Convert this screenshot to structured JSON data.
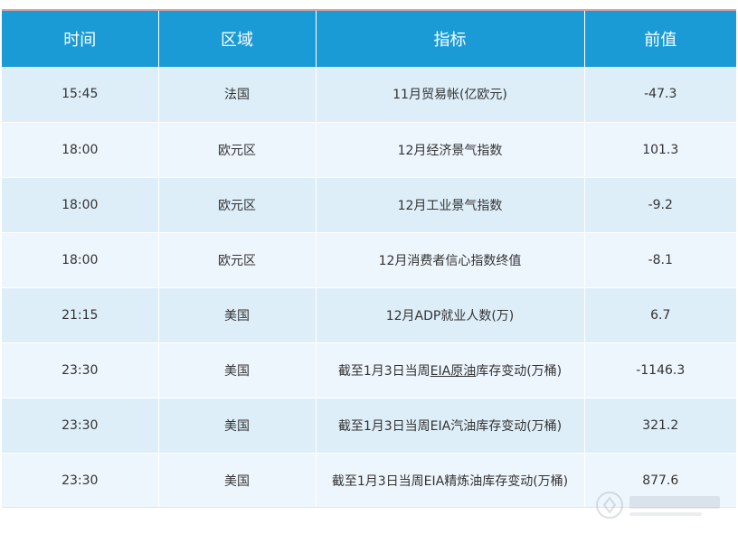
{
  "table": {
    "headers": [
      "时间",
      "区域",
      "指标",
      "前值"
    ],
    "rows": [
      {
        "time": "15:45",
        "region": "法国",
        "indicator_pre": "11月贸易帐(亿欧元)",
        "indicator_u": "",
        "indicator_post": "",
        "previous": "-47.3"
      },
      {
        "time": "18:00",
        "region": "欧元区",
        "indicator_pre": "12月经济景气指数",
        "indicator_u": "",
        "indicator_post": "",
        "previous": "101.3"
      },
      {
        "time": "18:00",
        "region": "欧元区",
        "indicator_pre": "12月工业景气指数",
        "indicator_u": "",
        "indicator_post": "",
        "previous": "-9.2"
      },
      {
        "time": "18:00",
        "region": "欧元区",
        "indicator_pre": "12月消费者信心指数终值",
        "indicator_u": "",
        "indicator_post": "",
        "previous": "-8.1"
      },
      {
        "time": "21:15",
        "region": "美国",
        "indicator_pre": "12月ADP就业人数(万)",
        "indicator_u": "",
        "indicator_post": "",
        "previous": "6.7"
      },
      {
        "time": "23:30",
        "region": "美国",
        "indicator_pre": "截至1月3日当周",
        "indicator_u": "EIA原油",
        "indicator_post": "库存变动(万桶)",
        "previous": "-1146.3"
      },
      {
        "time": "23:30",
        "region": "美国",
        "indicator_pre": "截至1月3日当周EIA汽油库存变动(万桶)",
        "indicator_u": "",
        "indicator_post": "",
        "previous": "321.2"
      },
      {
        "time": "23:30",
        "region": "美国",
        "indicator_pre": "截至1月3日当周EIA精炼油库存变动(万桶)",
        "indicator_u": "",
        "indicator_post": "",
        "previous": "877.6"
      }
    ]
  },
  "colors": {
    "header_bg": "#1b9bd6",
    "row_odd": "#ddeef9",
    "row_even": "#eef6fd"
  },
  "watermark": {
    "icon": "watermark-logo-icon"
  }
}
